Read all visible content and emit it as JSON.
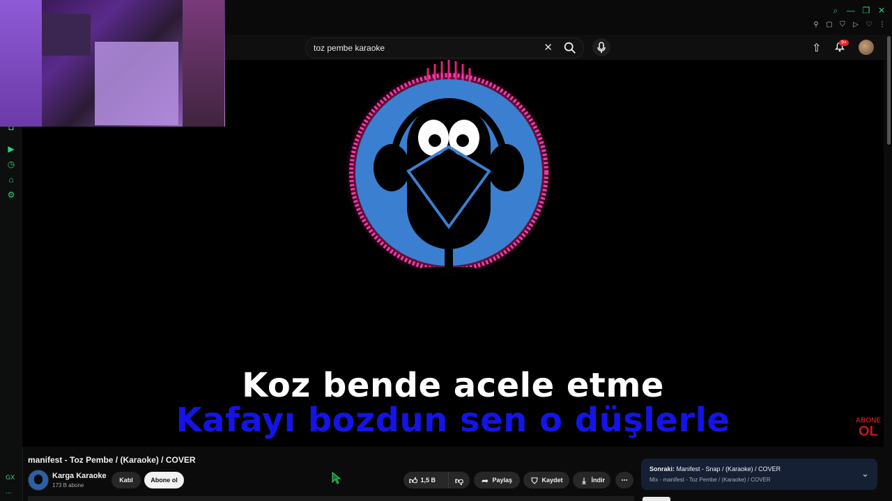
{
  "search": {
    "query": "toz pembe karaoke"
  },
  "header": {
    "notification_badge": "9+"
  },
  "video": {
    "lyric_current": "Koz bende acele etme",
    "lyric_next": "Kafayı bozdun sen o düşlerle",
    "corner_badge_top": "ABONE",
    "corner_badge_bottom": "OL"
  },
  "info": {
    "title": "manifest - Toz Pembe / (Karaoke) / COVER",
    "channel_name": "Karga Karaoke",
    "subscribers": "173 B abone",
    "join_label": "Katıl",
    "subscribe_label": "Abone ol",
    "like_count": "1,5 B",
    "share_label": "Paylaş",
    "save_label": "Kaydet",
    "download_label": "İndir"
  },
  "up_next": {
    "prefix": "Sonraki:",
    "title": "Manifest - Snap / (Karaoke) / COVER",
    "subtitle": "Mix - manifest - Toz Pembe / (Karaoke) / COVER"
  },
  "sidebar": {
    "bottom_label_1": "GX",
    "bottom_label_2": "..."
  },
  "colors": {
    "accent": "#2fd07a",
    "lyric_next": "#1414e6",
    "lyric_current": "#ffffff",
    "next_bg": "#152035"
  }
}
